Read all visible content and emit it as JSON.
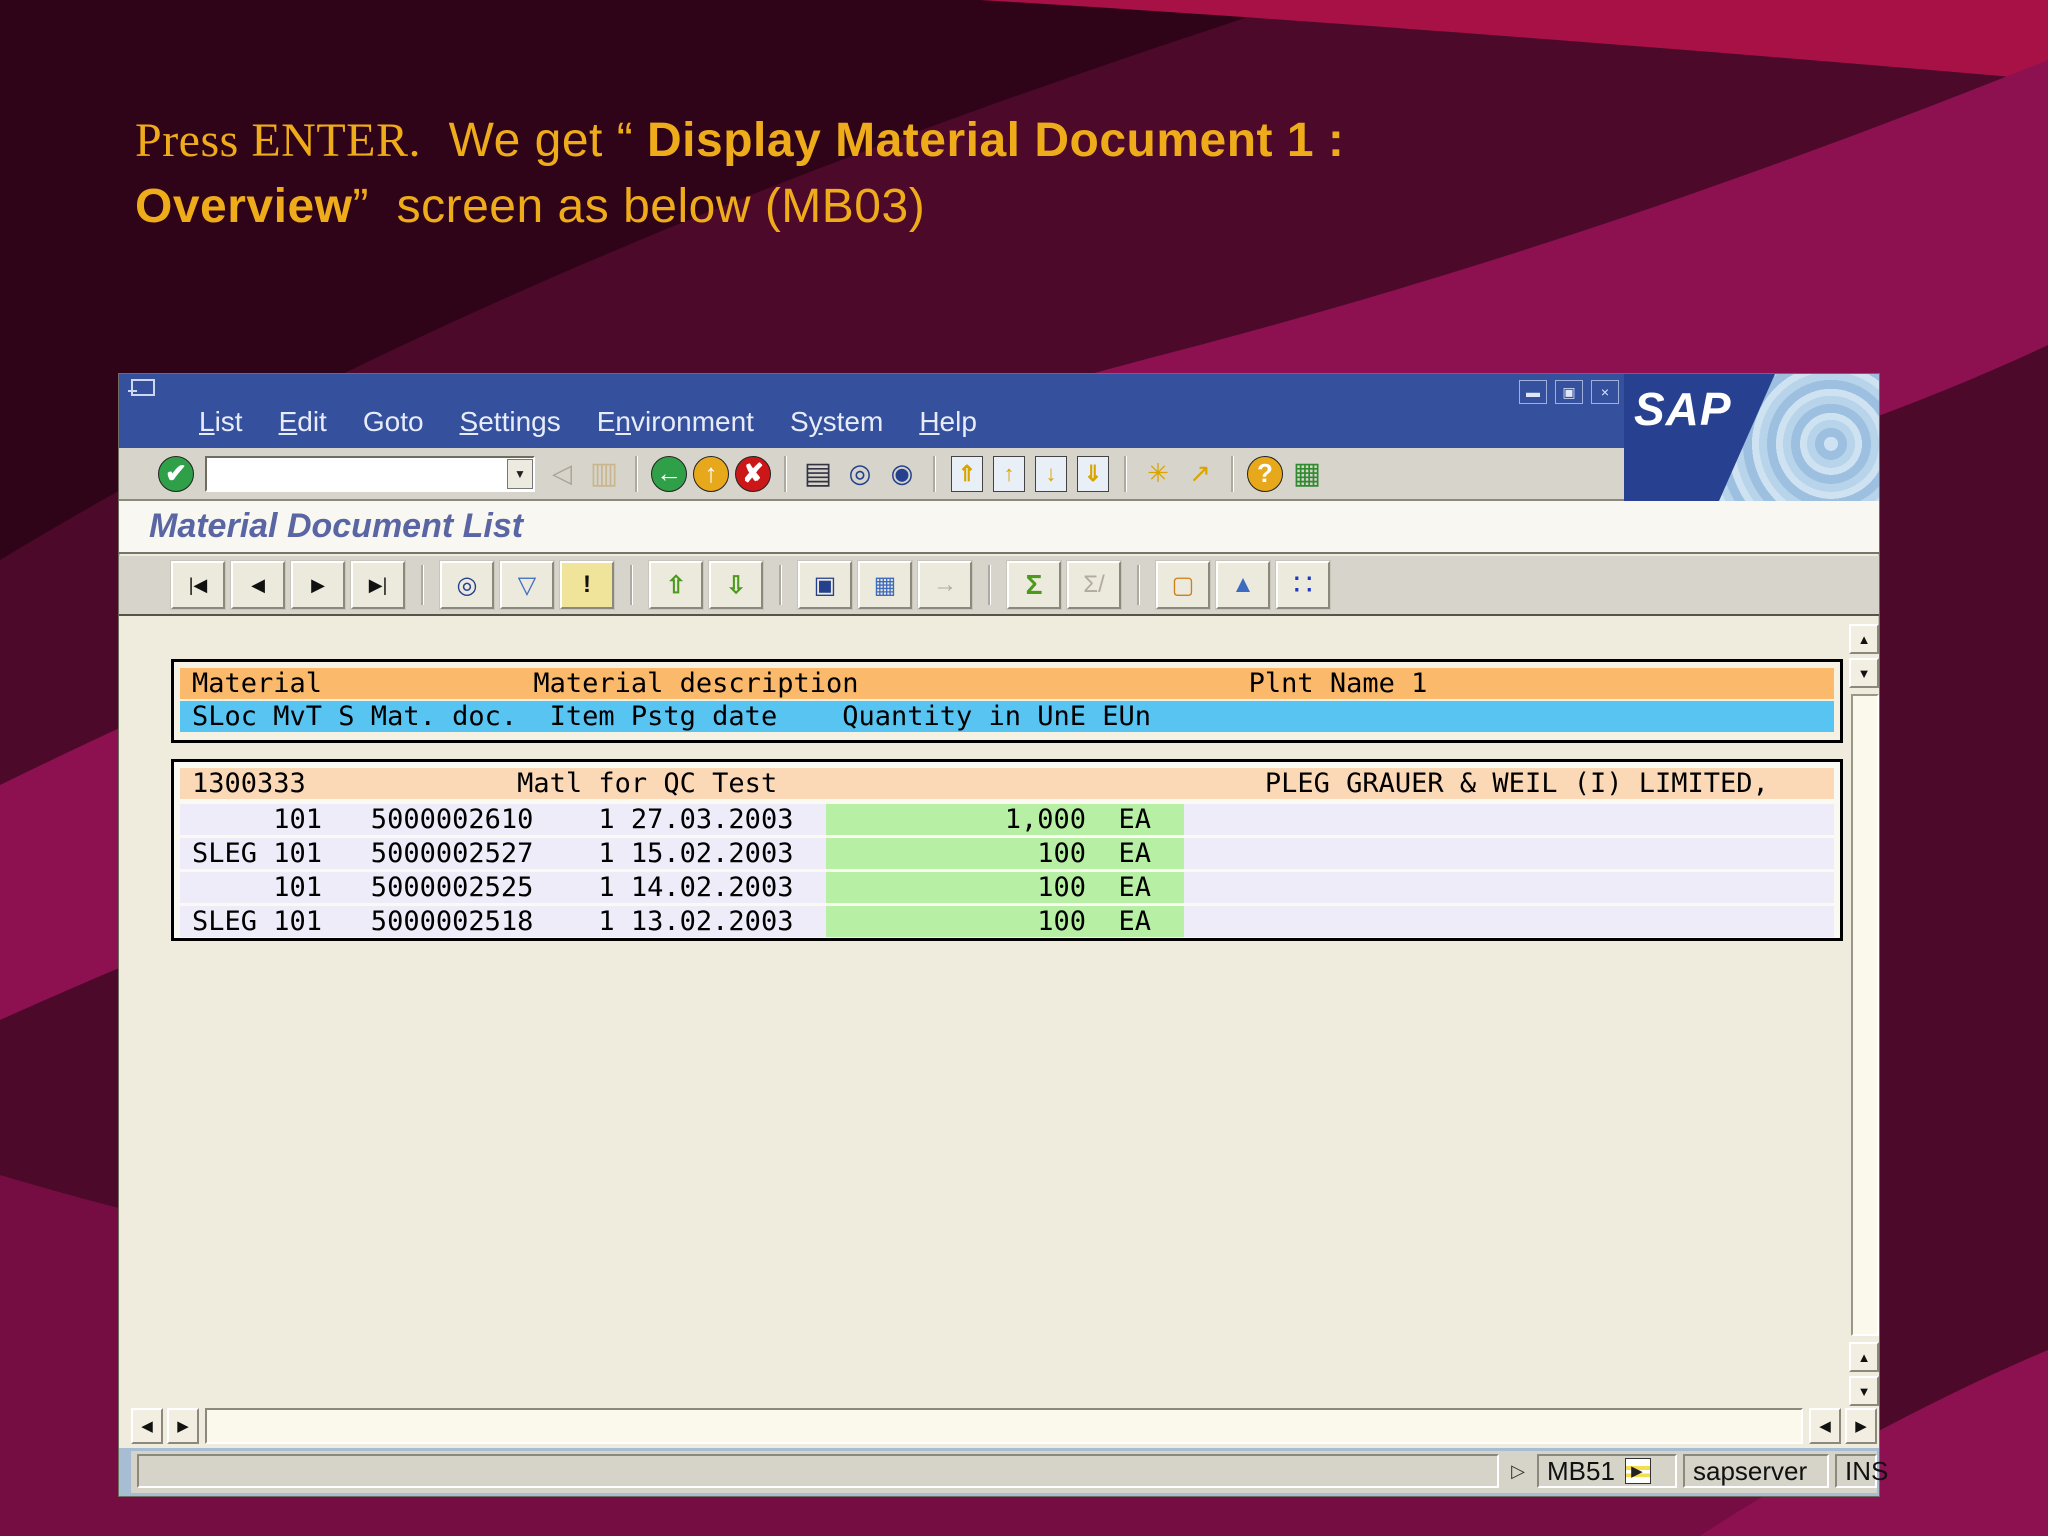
{
  "slide": {
    "title_line1_serif": "Press ENTER.",
    "title_line1_regular": "  We get “ ",
    "title_line1_bold": "Display Material Document  1 :",
    "title_line2_bold": "Overview",
    "title_line2_regular": "”  screen as below (MB03)"
  },
  "colors": {
    "slide_accent": "#EFAC1A",
    "menu_blue": "#35519E",
    "header_orange": "#FBB96B",
    "header_blue": "#58C4F2",
    "group_peach": "#FCD9B6",
    "row_lavender": "#EDECF8",
    "quantity_green": "#B7F0A4",
    "status_blue": "#A6BDD3"
  },
  "window": {
    "menu": {
      "items": [
        {
          "pre": "",
          "u": "L",
          "post": "ist"
        },
        {
          "pre": "",
          "u": "E",
          "post": "dit"
        },
        {
          "pre": "",
          "u": "",
          "post": "Goto"
        },
        {
          "pre": "",
          "u": "S",
          "post": "ettings"
        },
        {
          "pre": "E",
          "u": "n",
          "post": "vironment"
        },
        {
          "pre": "S",
          "u": "y",
          "post": "stem"
        },
        {
          "pre": "",
          "u": "H",
          "post": "elp"
        }
      ]
    },
    "controls": {
      "minimize": "▬",
      "restore": "▣",
      "close": "×"
    },
    "logo_text": "SAP",
    "screen_title": "Material Document List",
    "command_field": {
      "value": ""
    },
    "statusbar": {
      "message": "",
      "expand": "▷",
      "transaction": "MB51",
      "context_arrow": "▶",
      "server": "sapserver",
      "mode": "INS"
    }
  },
  "toolbar_icons": {
    "enter": "✔",
    "dropdown": "▼",
    "collapse": "◁",
    "save": "▥",
    "back": "←",
    "exit": "↑",
    "cancel": "✘",
    "print": "▤",
    "find": "◎",
    "find_next": "◉",
    "first_page": "⇑",
    "prev_page": "↑",
    "next_page": "↓",
    "last_page": "⇓",
    "new_session": "✳",
    "shortcut": "↗",
    "help": "?",
    "customize": "▦"
  },
  "apptoolbar_icons": {
    "first": "|◀",
    "prev": "◀",
    "next": "▶",
    "last": "▶|",
    "detail": "◎",
    "filter": "▽",
    "important": "!",
    "sort_asc": "⇧",
    "sort_desc": "⇩",
    "choose": "▣",
    "columns": "▦",
    "export": "→",
    "sum": "Σ",
    "subtotal": "Σ/",
    "layout": "▢",
    "graphic": "▲",
    "abc": "∷"
  },
  "scroll_icons": {
    "up": "▲",
    "down": "▼",
    "left": "◀",
    "right": "▶"
  },
  "table": {
    "header_line1": "Material             Material description                        Plnt Name 1",
    "header_line2": "SLoc MvT S Mat. doc.  Item Pstg date    Quantity in UnE EUn",
    "group_line": "1300333             Matl for QC Test                              PLEG GRAUER & WEIL (I) LIMITED,",
    "row_lines": [
      "     101   5000002610    1 27.03.2003             1,000  EA",
      "SLEG 101   5000002527    1 15.02.2003               100  EA",
      "     101   5000002525    1 14.02.2003               100  EA",
      "SLEG 101   5000002518    1 13.02.2003               100  EA"
    ],
    "material": {
      "number": "1300333",
      "description": "Matl for QC Test",
      "plant_name": "PLEG GRAUER & WEIL (I) LIMITED,"
    },
    "records": [
      {
        "sloc": "",
        "mvt": "101",
        "mat_doc": "5000002610",
        "item": "1",
        "pstg_date": "27.03.2003",
        "quantity": "1,000",
        "unit": "EA"
      },
      {
        "sloc": "SLEG",
        "mvt": "101",
        "mat_doc": "5000002527",
        "item": "1",
        "pstg_date": "15.02.2003",
        "quantity": "100",
        "unit": "EA"
      },
      {
        "sloc": "",
        "mvt": "101",
        "mat_doc": "5000002525",
        "item": "1",
        "pstg_date": "14.02.2003",
        "quantity": "100",
        "unit": "EA"
      },
      {
        "sloc": "SLEG",
        "mvt": "101",
        "mat_doc": "5000002518",
        "item": "1",
        "pstg_date": "13.02.2003",
        "quantity": "100",
        "unit": "EA"
      }
    ]
  }
}
